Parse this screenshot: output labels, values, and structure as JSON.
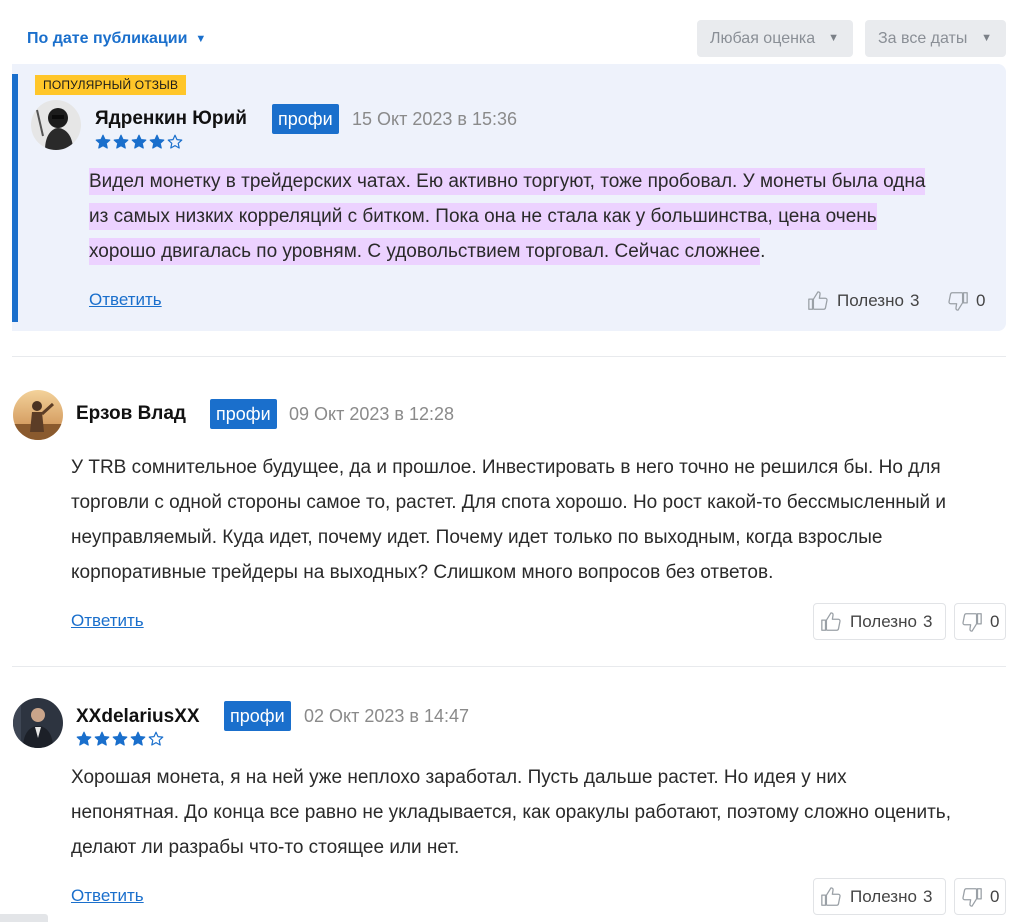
{
  "filters": {
    "sort_label": "По дате публикации",
    "rating_label": "Любая оценка",
    "date_label": "За все даты"
  },
  "reviews": [
    {
      "badge": "ПОПУЛЯРНЫЙ ОТЗЫВ",
      "author": "Ядренкин Юрий",
      "role": "профи",
      "date": "15 Окт 2023 в 15:36",
      "rating": 4,
      "text_lines": [
        "Видел монетку в трейдерских чатах. Ею активно торгуют, тоже пробовал. У монеты была одна",
        "из самых низких корреляций с битком. Пока она не стала как у большинства, цена очень",
        "хорошо двигалась по уровням. С удовольствием торговал. Сейчас сложнее"
      ],
      "text_end": ".",
      "reply_label": "Ответить",
      "useful_label": "Полезно",
      "useful_count": "3",
      "dislike_count": "0"
    },
    {
      "author": "Ерзов Влад",
      "role": "профи",
      "date": "09 Окт 2023 в 12:28",
      "text_lines": [
        "У TRB сомнительное будущее, да и прошлое. Инвестировать в него точно не решился бы. Но для",
        "торговли с одной стороны самое то, растет. Для спота хорошо. Но рост какой-то бессмысленный и",
        "неуправляемый. Куда идет, почему идет. Почему идет только по выходным, когда взрослые",
        "корпоративные трейдеры на выходных? Слишком много вопросов без ответов."
      ],
      "reply_label": "Ответить",
      "useful_label": "Полезно",
      "useful_count": "3",
      "dislike_count": "0"
    },
    {
      "author": "XXdelariusXX",
      "role": "профи",
      "date": "02 Окт 2023 в 14:47",
      "rating": 4,
      "text_lines": [
        "Хорошая монета, я на ней уже неплохо заработал. Пусть дальше растет. Но идея у них",
        "непонятная. До конца все равно не укладывается, как оракулы работают, поэтому сложно оценить,",
        "делают ли разрабы что-то стоящее или нет."
      ],
      "reply_label": "Ответить",
      "useful_label": "Полезно",
      "useful_count": "3",
      "dislike_count": "0"
    }
  ],
  "colors": {
    "accent": "#1a6fcc",
    "badge": "#ffc629",
    "highlight": "#ecd2ff",
    "popular_bg": "#eef2fb"
  },
  "icons": {
    "sort_caret": "caret-down-icon",
    "star_full": "star-filled-icon",
    "star_empty": "star-outline-icon",
    "like": "thumbs-up-icon",
    "dislike": "thumbs-down-icon"
  }
}
